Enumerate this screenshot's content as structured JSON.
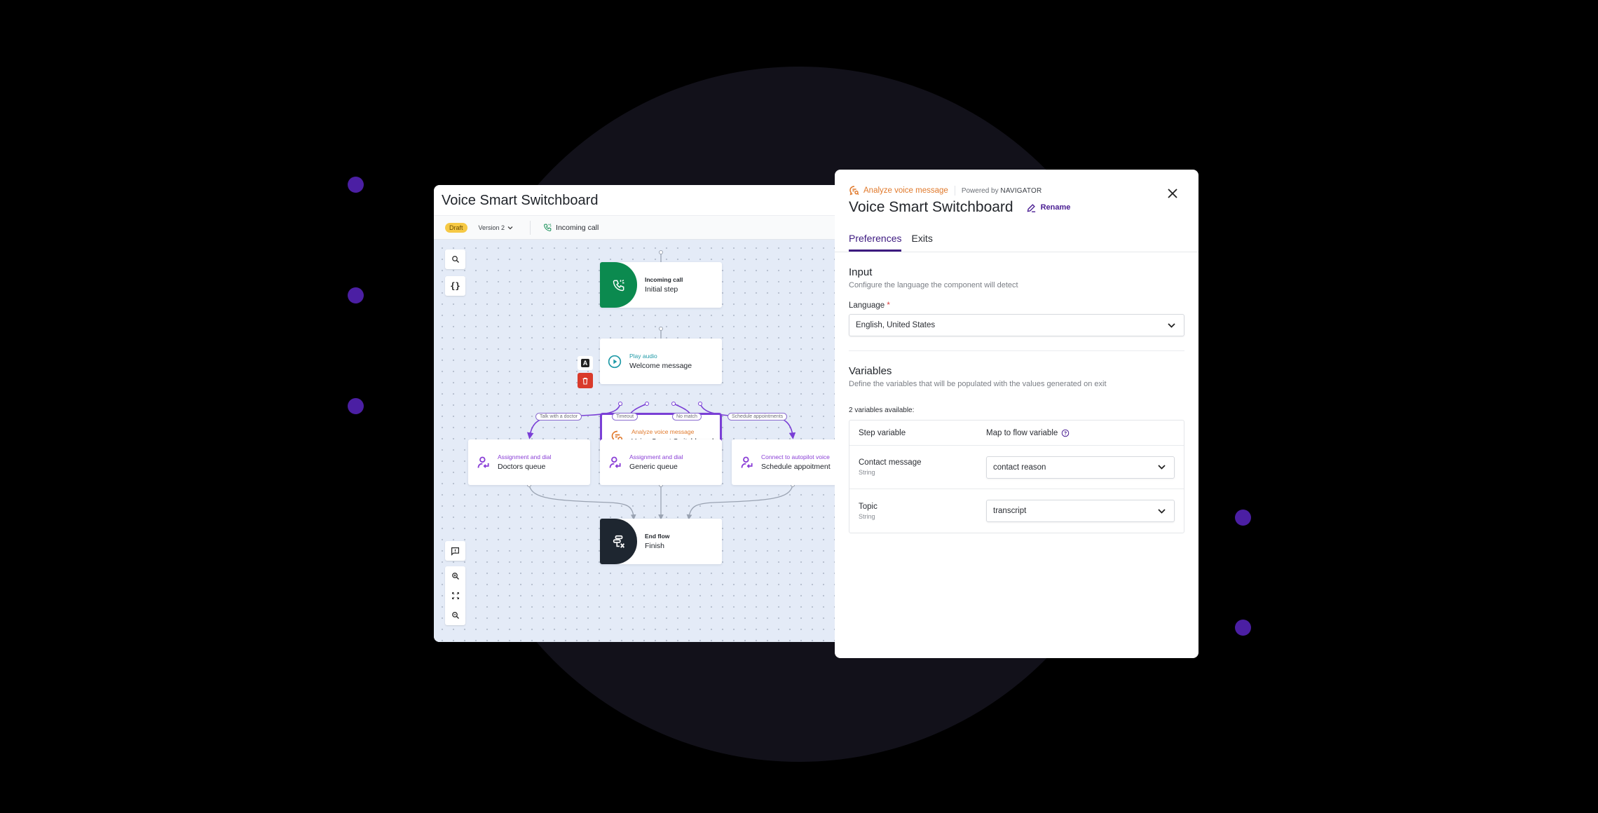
{
  "editor": {
    "title": "Voice Smart Switchboard",
    "status_badge": "Draft",
    "version_label": "Version 2",
    "trigger_label": "Incoming call"
  },
  "canvas": {
    "controls_top": [
      "search-icon",
      "braces-icon"
    ],
    "controls_bottom": [
      "feedback-icon",
      "zoom-in-icon",
      "fit-screen-icon",
      "zoom-out-icon"
    ],
    "node_actions": {
      "annotate_label": "A",
      "delete": "trash-icon"
    },
    "nodes": [
      {
        "id": "incoming",
        "kind": "Incoming call",
        "name": "Initial step",
        "icon": "phone-incoming-icon",
        "color": "#0b8a4f"
      },
      {
        "id": "play",
        "kind": "Play audio",
        "name": "Welcome message",
        "icon": "play-circle-icon",
        "color": "#1f9aa7"
      },
      {
        "id": "analyze",
        "kind": "Analyze voice message",
        "name": "Voice Smart Switchboard",
        "icon": "chat-search-icon",
        "color": "#e0792b",
        "selected": true
      },
      {
        "id": "doctors",
        "kind": "Assignment and dial",
        "name": "Doctors queue",
        "icon": "person-transfer-icon",
        "color": "#8a3fd6"
      },
      {
        "id": "generic",
        "kind": "Assignment and dial",
        "name": "Generic queue",
        "icon": "person-transfer-icon",
        "color": "#8a3fd6"
      },
      {
        "id": "schedule",
        "kind": "Connect to autopilot voice",
        "name": "Schedule appoitment",
        "icon": "person-transfer-icon",
        "color": "#8a3fd6"
      },
      {
        "id": "end",
        "kind": "End flow",
        "name": "Finish",
        "icon": "end-flow-icon",
        "color": "#1e2630"
      }
    ],
    "edge_labels": [
      "Talk with a doctor",
      "Timeout",
      "No match",
      "Schedule appointments"
    ]
  },
  "panel": {
    "component_kind": "Analyze voice message",
    "powered_by_prefix": "Powered by",
    "powered_by_brand": "NAVIGATOR",
    "title": "Voice Smart Switchboard",
    "rename_label": "Rename",
    "tabs": [
      {
        "label": "Preferences",
        "active": true
      },
      {
        "label": "Exits",
        "active": false
      }
    ],
    "input": {
      "title": "Input",
      "description": "Configure the language the component will detect",
      "language_label": "Language",
      "required_mark": "*",
      "language_value": "English, United States"
    },
    "variables": {
      "title": "Variables",
      "description": "Define the variables that will be populated with the values generated on exit",
      "count_label": "2 variables available:",
      "col_step": "Step variable",
      "col_map": "Map to flow variable",
      "rows": [
        {
          "name": "Contact message",
          "type": "String",
          "mapped": "contact reason"
        },
        {
          "name": "Topic",
          "type": "String",
          "mapped": "transcript"
        }
      ]
    }
  },
  "colors": {
    "accent": "#3d1a80",
    "selected_border": "#7a3fd6",
    "draft": "#f6c945",
    "background_dot": "#4b1fa3"
  }
}
